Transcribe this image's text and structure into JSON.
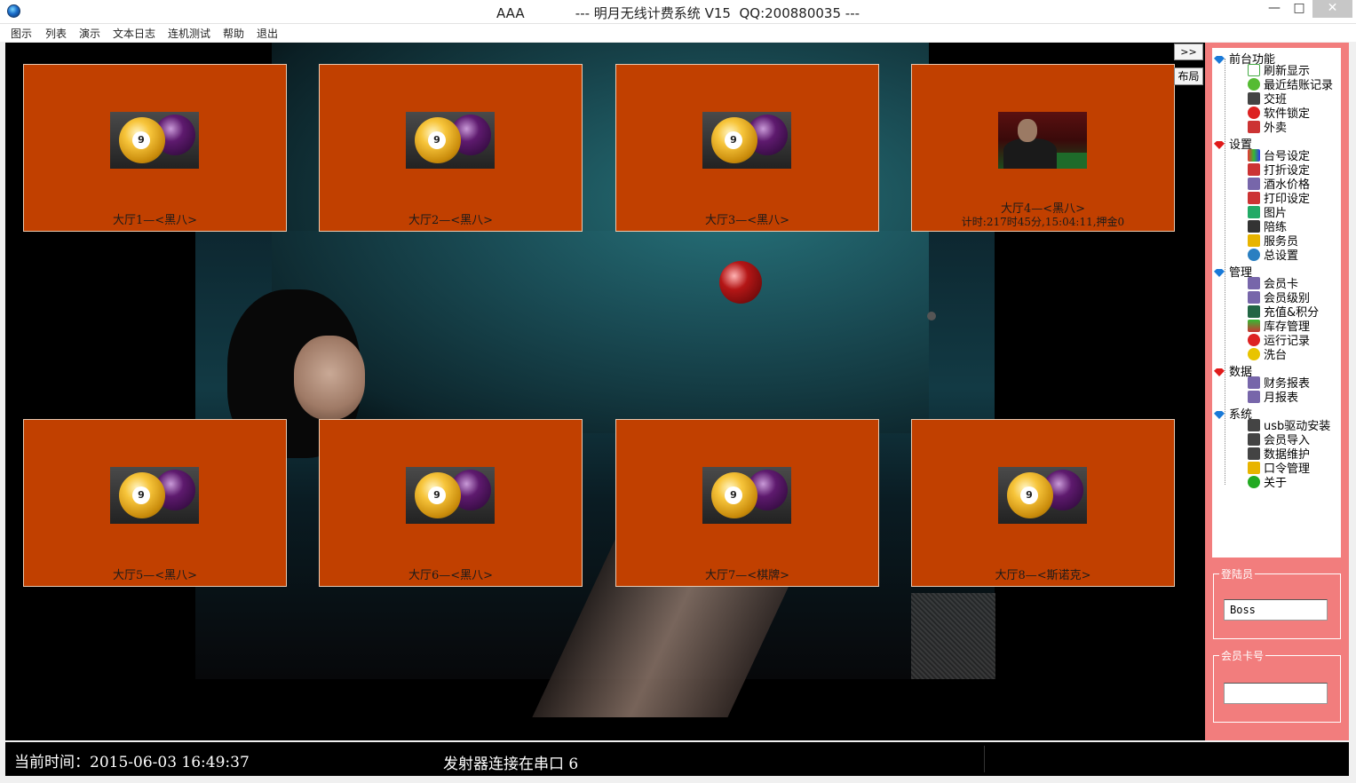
{
  "window": {
    "title": "AAA            --- 明月无线计费系统 V15  QQ:200880035 ---",
    "minimize": "—",
    "maximize": "□",
    "close": "✕"
  },
  "menu": [
    "图示",
    "列表",
    "演示",
    "文本日志",
    "连机测试",
    "帮助",
    "退出"
  ],
  "tables": [
    {
      "label": "大厅1—<黑八>",
      "icon": "billiard-balls-icon",
      "timer": ""
    },
    {
      "label": "大厅2—<黑八>",
      "icon": "billiard-balls-icon",
      "timer": ""
    },
    {
      "label": "大厅3—<黑八>",
      "icon": "billiard-balls-icon",
      "timer": ""
    },
    {
      "label": "大厅4—<黑八>",
      "icon": "player-photo-icon",
      "timer": "计时:217时45分,15:04:11,押金0"
    },
    {
      "label": "大厅5—<黑八>",
      "icon": "billiard-balls-icon",
      "timer": ""
    },
    {
      "label": "大厅6—<黑八>",
      "icon": "billiard-balls-icon",
      "timer": ""
    },
    {
      "label": "大厅7—<棋牌>",
      "icon": "billiard-balls-icon",
      "timer": ""
    },
    {
      "label": "大厅8—<斯诺克>",
      "icon": "billiard-balls-icon",
      "timer": ""
    }
  ],
  "ball_number": "9",
  "side_buttons": {
    "expand": ">>",
    "layout": "布局"
  },
  "tree": {
    "groups": [
      {
        "label": "前台功能",
        "gem": "blue",
        "items": [
          "刷新显示",
          "最近结账记录",
          "交班",
          "软件锁定",
          "外卖"
        ]
      },
      {
        "label": "设置",
        "gem": "red",
        "items": [
          "台号设定",
          "打折设定",
          "酒水价格",
          "打印设定",
          "图片",
          "陪练",
          "服务员",
          "总设置"
        ]
      },
      {
        "label": "管理",
        "gem": "blue",
        "items": [
          "会员卡",
          "会员级别",
          "充值&积分",
          "库存管理",
          "运行记录",
          "洗台"
        ]
      },
      {
        "label": "数据",
        "gem": "red",
        "items": [
          "财务报表",
          "月报表"
        ]
      },
      {
        "label": "系统",
        "gem": "blue",
        "items": [
          "usb驱动安装",
          "会员导入",
          "数据维护",
          "口令管理",
          "关于"
        ]
      }
    ]
  },
  "login": {
    "title": "登陆员",
    "value": "Boss"
  },
  "member": {
    "title": "会员卡号",
    "value": ""
  },
  "status": {
    "time": "当前时间：2015-06-03  16:49:37",
    "port": "发射器连接在串口 6"
  },
  "colors": {
    "tile": "#c14000",
    "panel": "#f27d7d",
    "stage": "#000000"
  }
}
